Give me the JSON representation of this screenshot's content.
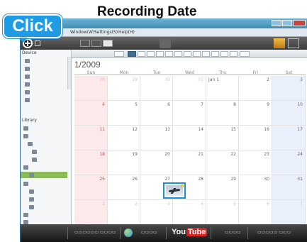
{
  "callouts": {
    "recording_date": "Recording Date",
    "click": "Click"
  },
  "menu": {
    "items": [
      "Window(W)",
      "Settings(S)",
      "Help(H)"
    ]
  },
  "sidebar": {
    "device_header": "Device",
    "library_header": "Library"
  },
  "calendar": {
    "month_title": "1/2009",
    "weekdays": [
      "Sun",
      "Mon",
      "Tue",
      "Wed",
      "Thu",
      "Fri",
      "Sat"
    ],
    "weeks": [
      [
        "28",
        "29",
        "30",
        "31",
        "Jan 1",
        "2",
        "3"
      ],
      [
        "4",
        "5",
        "6",
        "7",
        "8",
        "9",
        "10"
      ],
      [
        "11",
        "12",
        "13",
        "14",
        "15",
        "16",
        "17"
      ],
      [
        "18",
        "19",
        "20",
        "21",
        "22",
        "23",
        "24"
      ],
      [
        "25",
        "26",
        "27",
        "28",
        "29",
        "30",
        "31"
      ],
      [
        "1",
        "2",
        "3",
        "4",
        "5",
        "6",
        "7"
      ]
    ]
  },
  "bottombar": {
    "youtube": "You",
    "youtube_tube": "Tube"
  },
  "colors": {
    "accent": "#1e9be3",
    "selected": "#8dbb5a",
    "sunday": "#d04c4c"
  }
}
